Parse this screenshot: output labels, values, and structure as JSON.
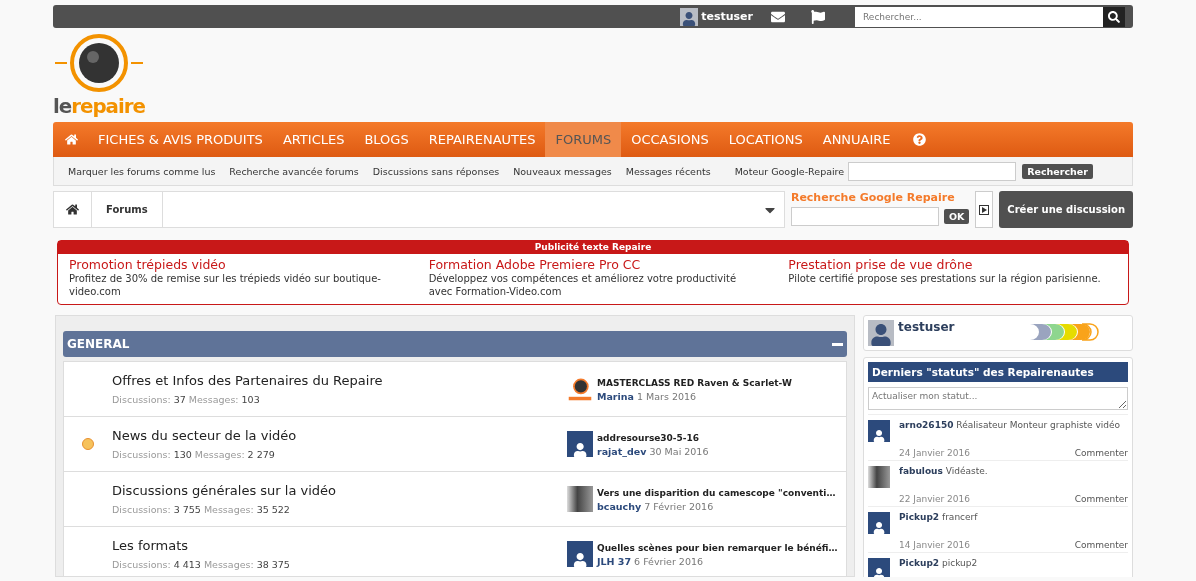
{
  "top_bar": {
    "username": "testuser",
    "search": {
      "placeholder": "Rechercher..."
    }
  },
  "logo": {
    "text_left": "le",
    "text_right": "repaire"
  },
  "nav": [
    {
      "label": "FICHES & AVIS PRODUITS",
      "selected": false
    },
    {
      "label": "ARTICLES",
      "selected": false
    },
    {
      "label": "BLOGS",
      "selected": false
    },
    {
      "label": "REPAIRENAUTES",
      "selected": false
    },
    {
      "label": "FORUMS",
      "selected": true
    },
    {
      "label": "OCCASIONS",
      "selected": false
    },
    {
      "label": "LOCATIONS",
      "selected": false
    },
    {
      "label": "ANNUAIRE",
      "selected": false
    }
  ],
  "sub_nav": {
    "links": [
      "Marquer les forums comme lus",
      "Recherche avancée forums",
      "Discussions sans réponses",
      "Nouveaux messages",
      "Messages récents"
    ],
    "google_label": "Moteur Google-Repaire",
    "google_button": "Rechercher"
  },
  "breadcrumb": {
    "items": [
      "Forums"
    ],
    "google_title": "Recherche Google Repaire",
    "ok_button": "OK",
    "create_button": "Créer une discussion"
  },
  "ads": {
    "title": "Publicité texte Repaire",
    "items": [
      {
        "title": "Promotion trépieds vidéo",
        "text": "Profitez de 30% de remise sur les trépieds vidéo sur boutique-video.com"
      },
      {
        "title": "Formation Adobe Premiere Pro CC",
        "text": "Développez vos compétences et améliorez votre productivité avec Formation-Video.com"
      },
      {
        "title": "Prestation prise de vue drône",
        "text": "Pilote certifié propose ses prestations sur la région parisienne."
      }
    ]
  },
  "category": {
    "title": "GENERAL",
    "expanded": true,
    "forums": [
      {
        "name": "Offres et Infos des Partenaires du Repaire",
        "unread": false,
        "discussions_label": "Discussions:",
        "discussions": "37",
        "messages_label": "Messages:",
        "messages": "103",
        "last_title": "MASTERCLASS RED Raven & Scarlet-W",
        "last_user": "Marina",
        "last_date": "1 Mars 2016",
        "avatar": {
          "kind": "logo"
        }
      },
      {
        "name": "News du secteur de la vidéo",
        "unread": true,
        "discussions_label": "Discussions:",
        "discussions": "130",
        "messages_label": "Messages:",
        "messages": "2 279",
        "last_title": "addresourse30-5-16",
        "last_user": "rajat_dev",
        "last_date": "30 Mai 2016",
        "avatar": {
          "kind": "default"
        }
      },
      {
        "name": "Discussions générales sur la vidéo",
        "unread": false,
        "discussions_label": "Discussions:",
        "discussions": "3 755",
        "messages_label": "Messages:",
        "messages": "35 522",
        "last_title": "Vers une disparition du camescope \"conventi…",
        "last_user": "bcauchy",
        "last_date": "7 Février 2016",
        "avatar": {
          "kind": "photo"
        }
      },
      {
        "name": "Les formats",
        "unread": false,
        "discussions_label": "Discussions:",
        "discussions": "4 413",
        "messages_label": "Messages:",
        "messages": "38 375",
        "last_title": "Quelles scènes pour bien remarquer le bénéfi…",
        "last_user": "JLH 37",
        "last_date": "6 Février 2016",
        "avatar": {
          "kind": "default"
        }
      }
    ]
  },
  "sidebar": {
    "username": "testuser",
    "statuses_title": "Derniers \"statuts\" des Repairenautes",
    "status_placeholder": "Actualiser mon statut...",
    "statuses": [
      {
        "user": "arno26150",
        "text": "Réalisateur Monteur graphiste vidéo",
        "date": "24 Janvier 2016",
        "action": "Commenter",
        "avatar": {
          "kind": "default"
        }
      },
      {
        "user": "fabulous",
        "text": "Vidéaste.",
        "date": "22 Janvier 2016",
        "action": "Commenter",
        "avatar": {
          "kind": "photo"
        }
      },
      {
        "user": "Pickup2",
        "text": "francerf",
        "date": "14 Janvier 2016",
        "action": "Commenter",
        "avatar": {
          "kind": "default"
        }
      },
      {
        "user": "Pickup2",
        "text": "pickup2",
        "avatar": {
          "kind": "default"
        }
      }
    ]
  }
}
